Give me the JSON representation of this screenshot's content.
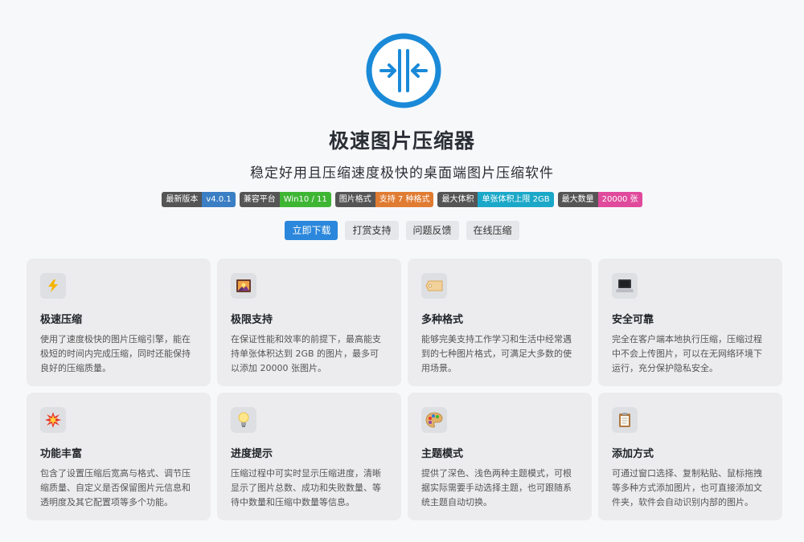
{
  "app": {
    "title": "极速图片压缩器",
    "subtitle": "稳定好用且压缩速度极快的桌面端图片压缩软件",
    "brand_color": "#1a8ad8"
  },
  "badges": [
    {
      "key": "最新版本",
      "value": "v4.0.1",
      "color": "#3a7ec4"
    },
    {
      "key": "兼容平台",
      "value": "Win10 / 11",
      "color": "#3fb534"
    },
    {
      "key": "图片格式",
      "value": "支持 7 种格式",
      "color": "#e07b32"
    },
    {
      "key": "最大体积",
      "value": "单张体积上限 2GB",
      "color": "#1ba8c8"
    },
    {
      "key": "最大数量",
      "value": "20000 张",
      "color": "#e04a9c"
    }
  ],
  "buttons": {
    "download": "立即下载",
    "donate": "打赏支持",
    "feedback": "问题反馈",
    "online": "在线压缩"
  },
  "features": [
    {
      "icon": "lightning-icon",
      "title": "极速压缩",
      "desc": "使用了速度极快的图片压缩引擎，能在极短的时间内完成压缩，同时还能保持良好的压缩质量。"
    },
    {
      "icon": "picture-icon",
      "title": "极限支持",
      "desc": "在保证性能和效率的前提下，最高能支持单张体积达到 2GB 的图片，最多可以添加 20000 张图片。"
    },
    {
      "icon": "tag-icon",
      "title": "多种格式",
      "desc": "能够完美支持工作学习和生活中经常遇到的七种图片格式，可满足大多数的使用场景。"
    },
    {
      "icon": "laptop-icon",
      "title": "安全可靠",
      "desc": "完全在客户端本地执行压缩，压缩过程中不会上传图片，可以在无网络环境下运行，充分保护隐私安全。"
    },
    {
      "icon": "explosion-icon",
      "title": "功能丰富",
      "desc": "包含了设置压缩后宽高与格式、调节压缩质量、自定义是否保留图片元信息和透明度及其它配置项等多个功能。"
    },
    {
      "icon": "lightbulb-icon",
      "title": "进度提示",
      "desc": "压缩过程中可实时显示压缩进度，清晰显示了图片总数、成功和失败数量、等待中数量和压缩中数量等信息。"
    },
    {
      "icon": "palette-icon",
      "title": "主题模式",
      "desc": "提供了深色、浅色两种主题模式，可根据实际需要手动选择主题，也可跟随系统主题自动切换。"
    },
    {
      "icon": "clipboard-icon",
      "title": "添加方式",
      "desc": "可通过窗口选择、复制粘贴、鼠标拖拽等多种方式添加图片，也可直接添加文件夹，软件会自动识别内部的图片。"
    }
  ]
}
